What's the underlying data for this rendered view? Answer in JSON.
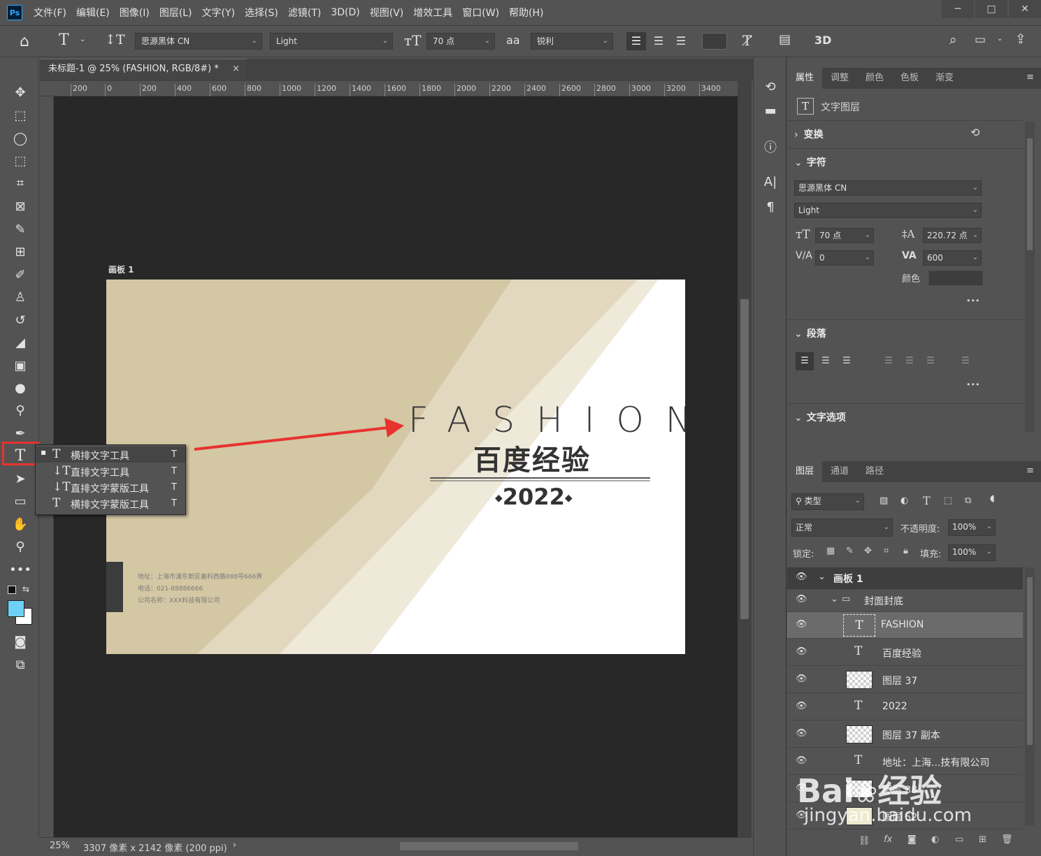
{
  "app": {
    "logo": "Ps",
    "menu": [
      "文件(F)",
      "编辑(E)",
      "图像(I)",
      "图层(L)",
      "文字(Y)",
      "选择(S)",
      "滤镜(T)",
      "3D(D)",
      "视图(V)",
      "增效工具",
      "窗口(W)",
      "帮助(H)"
    ]
  },
  "options": {
    "font_family": "思源黑体 CN",
    "font_style": "Light",
    "font_size": "70 点",
    "antialias_label": "aa",
    "antialias": "锐利",
    "three_d": "3D"
  },
  "document": {
    "tab_title": "未标题-1 @ 25% (FASHION, RGB/8#) *",
    "zoom": "25%",
    "size_info": "3307 像素 x 2142 像素 (200 ppi)",
    "ruler_h": [
      "200",
      "0",
      "200",
      "400",
      "600",
      "800",
      "1000",
      "1200",
      "1400",
      "1600",
      "1800",
      "2000",
      "2200",
      "2400",
      "2600",
      "2800",
      "3000",
      "3200",
      "3400"
    ],
    "artboard_label": "画板 1"
  },
  "design": {
    "title_en": "FASHION",
    "title_cn": "百度经验",
    "year": "2022",
    "address": "地址：上海市浦东新区嘉科西路888号666弄",
    "phone": "电话：021-88886666",
    "company": "公司名称：XXX科技有限公司",
    "colors": {
      "beige_dark": "#d4c7a4",
      "beige_mid": "#e2d8bf",
      "beige_light": "#efe9da",
      "text": "#333333"
    }
  },
  "flyout": {
    "items": [
      {
        "label": "横排文字工具",
        "key": "T"
      },
      {
        "label": "直排文字工具",
        "key": "T"
      },
      {
        "label": "直排文字蒙版工具",
        "key": "T"
      },
      {
        "label": "横排文字蒙版工具",
        "key": "T"
      }
    ]
  },
  "properties": {
    "tabs": [
      "属性",
      "调整",
      "颜色",
      "色板",
      "渐变"
    ],
    "layer_kind": "文字图层",
    "transform": "变换",
    "character": "字符",
    "font_family": "思源黑体 CN",
    "font_style": "Light",
    "size": "70 点",
    "leading": "220.72 点",
    "kerning": "0",
    "tracking": "600",
    "color_label": "颜色",
    "paragraph": "段落",
    "text_options": "文字选项",
    "more": "•••"
  },
  "layers": {
    "tabs": [
      "图层",
      "通道",
      "路径"
    ],
    "filter_kind": "类型",
    "blend_mode": "正常",
    "opacity_label": "不透明度:",
    "opacity": "100%",
    "lock_label": "锁定:",
    "fill_label": "填充:",
    "fill": "100%",
    "rows": [
      {
        "name": "画板 1",
        "type": "artboard"
      },
      {
        "name": "封面封底",
        "type": "group"
      },
      {
        "name": "FASHION",
        "type": "text",
        "selected": true
      },
      {
        "name": "百度经验",
        "type": "text"
      },
      {
        "name": "图层 37",
        "type": "pixel"
      },
      {
        "name": "2022",
        "type": "text"
      },
      {
        "name": "图层 37 副本",
        "type": "pixel"
      },
      {
        "name": "地址：上海...技有限公司",
        "type": "text"
      },
      {
        "name": "图层 38",
        "type": "pixel"
      },
      {
        "name": "图层 52",
        "type": "pixel"
      }
    ]
  },
  "watermark": {
    "brand": "Bai",
    "brand2": "经验",
    "url": "jingyan.baidu.com"
  }
}
